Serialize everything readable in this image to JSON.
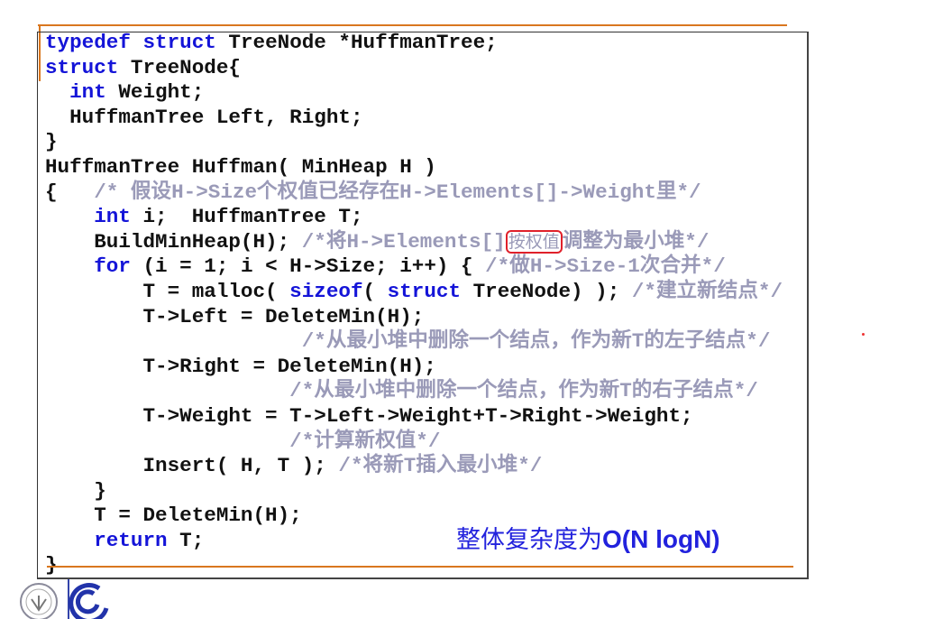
{
  "colors": {
    "keyword": "#1414d8",
    "comment": "#9a9ab8",
    "annotation": "#e0202a",
    "accent_rule": "#d9771f",
    "note": "#2222dd"
  },
  "code_lines": [
    [
      [
        "k",
        "typedef"
      ],
      [
        "p",
        " "
      ],
      [
        "k",
        "struct"
      ],
      [
        "p",
        " TreeNode *HuffmanTree;"
      ]
    ],
    [
      [
        "k",
        "struct"
      ],
      [
        "p",
        " TreeNode{"
      ]
    ],
    [
      [
        "p",
        "  "
      ],
      [
        "k",
        "int"
      ],
      [
        "p",
        " Weight;"
      ]
    ],
    [
      [
        "p",
        "  HuffmanTree Left, Right;"
      ]
    ],
    [
      [
        "p",
        "}"
      ]
    ],
    [
      [
        "p",
        "HuffmanTree Huffman( MinHeap H )"
      ]
    ],
    [
      [
        "p",
        "{   "
      ],
      [
        "c",
        "/* 假设H->Size个权值已经存在H->Elements[]->Weight里*/"
      ]
    ],
    [
      [
        "p",
        "    "
      ],
      [
        "k",
        "int"
      ],
      [
        "p",
        " i;  HuffmanTree T;"
      ]
    ],
    [
      [
        "p",
        "    BuildMinHeap(H); "
      ],
      [
        "c",
        "/*将H->Elements[]"
      ],
      [
        "m",
        "按权值"
      ],
      [
        "c",
        "调整为最小堆*/"
      ]
    ],
    [
      [
        "p",
        "    "
      ],
      [
        "k",
        "for"
      ],
      [
        "p",
        " (i = 1; i < H->Size; i++) { "
      ],
      [
        "c",
        "/*做H->Size-1次合并*/"
      ]
    ],
    [
      [
        "p",
        "        T = malloc( "
      ],
      [
        "k",
        "sizeof"
      ],
      [
        "p",
        "( "
      ],
      [
        "k",
        "struct"
      ],
      [
        "p",
        " TreeNode) ); "
      ],
      [
        "c",
        "/*建立新结点*/"
      ]
    ],
    [
      [
        "p",
        "        T->Left = DeleteMin(H);"
      ]
    ],
    [
      [
        "p",
        "                     "
      ],
      [
        "c",
        "/*从最小堆中删除一个结点，作为新T的左子结点*/"
      ]
    ],
    [
      [
        "p",
        "        T->Right = DeleteMin(H);"
      ]
    ],
    [
      [
        "p",
        "                    "
      ],
      [
        "c",
        "/*从最小堆中删除一个结点，作为新T的右子结点*/"
      ]
    ],
    [
      [
        "p",
        "        T->Weight = T->Left->Weight+T->Right->Weight;"
      ]
    ],
    [
      [
        "p",
        "                    "
      ],
      [
        "c",
        "/*计算新权值*/"
      ]
    ],
    [
      [
        "p",
        "        Insert( H, T ); "
      ],
      [
        "c",
        "/*将新T插入最小堆*/"
      ]
    ],
    [
      [
        "p",
        "    }"
      ]
    ],
    [
      [
        "p",
        "    T = DeleteMin(H);"
      ]
    ],
    [
      [
        "p",
        "    "
      ],
      [
        "k",
        "return"
      ],
      [
        "p",
        " T;"
      ]
    ],
    [
      [
        "p",
        "}"
      ]
    ]
  ],
  "note": {
    "prefix": "整体复杂度为",
    "complexity": "O(N logN)"
  }
}
